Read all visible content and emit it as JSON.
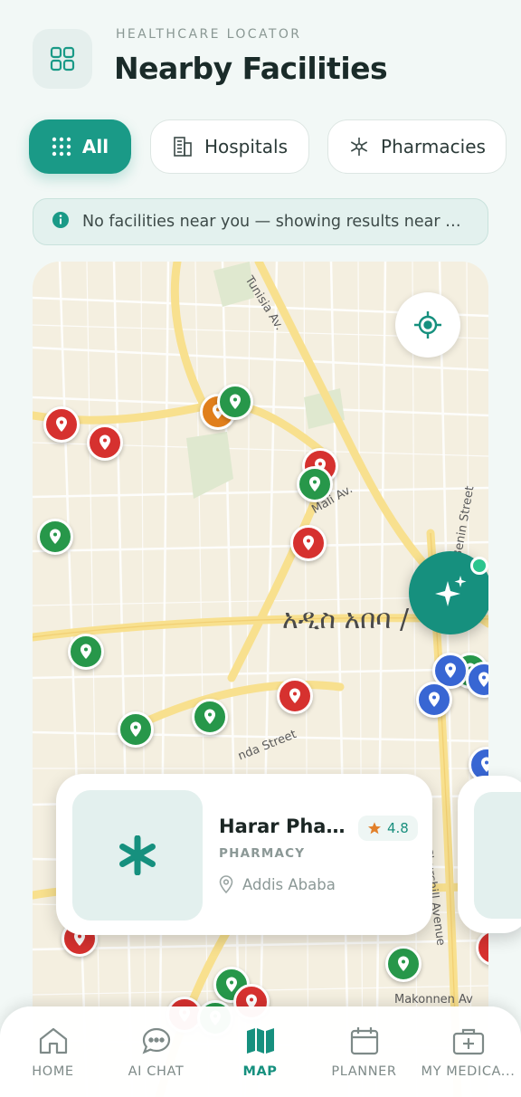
{
  "header": {
    "eyebrow": "HEALTHCARE LOCATOR",
    "title": "Nearby Facilities",
    "menu_icon": "grid-icon"
  },
  "filters": [
    {
      "label": "All",
      "icon": "dots-grid-icon",
      "active": true
    },
    {
      "label": "Hospitals",
      "icon": "building-icon",
      "active": false
    },
    {
      "label": "Pharmacies",
      "icon": "snowflake-icon",
      "active": false
    }
  ],
  "notice": {
    "icon": "info-icon",
    "text": "No facilities near you — showing results near Addis Ababa"
  },
  "map": {
    "city_label": "አዲስ አበባ / ",
    "street_labels": [
      "Tunisia Av.",
      "Mali Av.",
      "Benin Street",
      "Churchill Avenue",
      "Makonnen Av",
      "nda Street"
    ],
    "marker_colors": {
      "hospital": "#d6312f",
      "pharmacy": "#27974a",
      "clinic": "#3866d3",
      "other": "#e07f1c"
    }
  },
  "facility_card": {
    "name": "Harar Pharmacy",
    "rating": "4.8",
    "type": "PHARMACY",
    "location": "Addis Ababa"
  },
  "nav": [
    {
      "label": "HOME",
      "icon": "home-icon",
      "active": false
    },
    {
      "label": "AI CHAT",
      "icon": "chat-icon",
      "active": false
    },
    {
      "label": "MAP",
      "icon": "map-icon",
      "active": true
    },
    {
      "label": "PLANNER",
      "icon": "calendar-icon",
      "active": false
    },
    {
      "label": "MY MEDICA...",
      "icon": "medical-kit-icon",
      "active": false
    }
  ],
  "colors": {
    "accent": "#1a9a87",
    "background": "#f2f8f6"
  }
}
